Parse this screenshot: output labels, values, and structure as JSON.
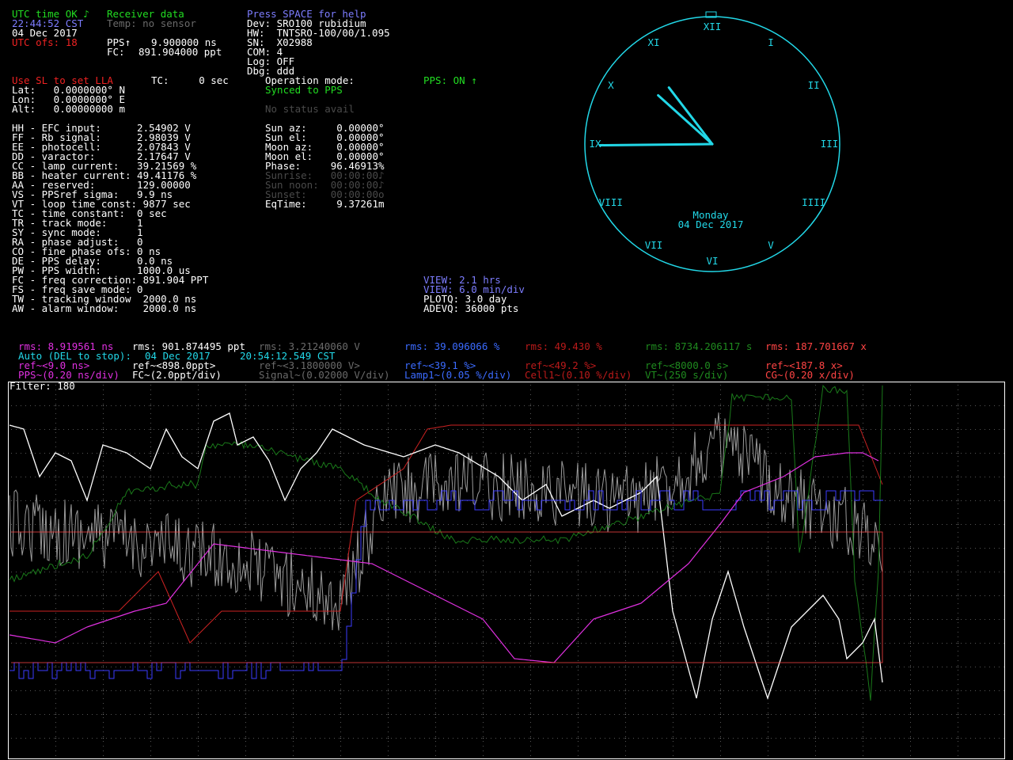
{
  "status": {
    "utc": "UTC time OK ♪",
    "time": "22:44:52 CST",
    "date": "04 Dec 2017",
    "utc_ofs": "UTC ofs: 18"
  },
  "receiver": {
    "title": "Receiver data",
    "temp": "Temp: no sensor",
    "pps_label": "PPS↑",
    "pps_value": "9.900000 ns",
    "fc_label": "FC:",
    "fc_value": "891.904000 ppt"
  },
  "device": {
    "help": "Press SPACE for help",
    "dev": "Dev: SRO100 rubidium",
    "hw": "HW:  TNTSRO-100/00/1.095",
    "sn": "SN:  X02988",
    "com": "COM: 4",
    "log": "Log: OFF",
    "dbg": "Dbg: ddd"
  },
  "location": {
    "hint": "Use SL to set LLA",
    "lat": "Lat:   0.0000000° N",
    "lon": "Lon:   0.0000000° E",
    "alt": "Alt:   0.00000000 m"
  },
  "tc_line": "TC:     0 sec",
  "operation": {
    "mode_label": "Operation mode:",
    "sync": "Synced to PPS",
    "no_status": "No status avail",
    "pps_on": "PPS: ON ↑"
  },
  "params": [
    "HH - EFC input:      2.54902 V",
    "FF - Rb signal:      2.98039 V",
    "EE - photocell:      2.07843 V",
    "DD - varactor:       2.17647 V",
    "CC - lamp current:   39.21569 %",
    "BB - heater current: 49.41176 %",
    "AA - reserved:       129.00000",
    "VS - PPSref sigma:   9.9 ns",
    "VT - loop time const: 9877 sec",
    "TC - time constant:  0 sec",
    "TR - track mode:     1",
    "SY - sync mode:      1",
    "RA - phase adjust:   0",
    "CO - fine phase ofs: 0 ns",
    "DE - PPS delay:      0.0 ns",
    "PW - PPS width:      1000.0 us",
    "FC - freq correction: 891.904 PPT",
    "FS - freq save mode: 0",
    "TW - tracking window  2000.0 ns",
    "AW - alarm window:    2000.0 ns"
  ],
  "astro": [
    {
      "text": "Sun az:     0.00000°",
      "dim": false
    },
    {
      "text": "Sun el:     0.00000°",
      "dim": false
    },
    {
      "text": "Moon az:    0.00000°",
      "dim": false
    },
    {
      "text": "Moon el:    0.00000°",
      "dim": false
    },
    {
      "text": "Phase:     96.46913%",
      "dim": false
    },
    {
      "text": "Sunrise:   00:00:00♪",
      "dim": true
    },
    {
      "text": "Sun noon:  00:00:00♪",
      "dim": true
    },
    {
      "text": "Sunset:    00:00:00o",
      "dim": true
    },
    {
      "text": "EqTime:     9.37261m",
      "dim": false
    }
  ],
  "view": {
    "span": "VIEW: 2.1 hrs",
    "div": "VIEW: 6.0 min/div",
    "plotq": "PLOTQ: 3.0 day",
    "adevq": "ADEVQ: 36000 pts"
  },
  "clock": {
    "day": "Monday",
    "date": "04 Dec 2017",
    "numerals": [
      "XII",
      "I",
      "II",
      "III",
      "IIII",
      "V",
      "VI",
      "VII",
      "VIII",
      "IX",
      "X",
      "XI"
    ],
    "hour": 10.75,
    "minute": 44.9,
    "second": 52,
    "color": "#22d8e8"
  },
  "rms_row": [
    {
      "text": "rms: 8.919561 ns",
      "cls": "mag"
    },
    {
      "text": "rms: 901.874495 ppt",
      "cls": "white"
    },
    {
      "text": "rms: 3.21240060 V",
      "cls": "gray"
    },
    {
      "text": "rms: 39.096066 %",
      "cls": "sblue"
    },
    {
      "text": "rms: 49.430 %",
      "cls": "dred"
    },
    {
      "text": "rms: 8734.206117 s",
      "cls": "dgreen"
    },
    {
      "text": "rms: 187.701667 x",
      "cls": "cg"
    }
  ],
  "auto_row": {
    "auto": "Auto (DEL to stop):",
    "date": "04 Dec 2017",
    "time": "20:54:12.549 CST"
  },
  "ref_row": [
    {
      "text": "ref~<9.0 ns>",
      "cls": "mag"
    },
    {
      "text": "ref~<898.0ppt>",
      "cls": "white"
    },
    {
      "text": "ref~<3.1800000 V>",
      "cls": "gray"
    },
    {
      "text": "ref~<39.1 %>",
      "cls": "sblue"
    },
    {
      "text": "ref~<49.2 %>",
      "cls": "dred"
    },
    {
      "text": "ref~<8000.0 s>",
      "cls": "dgreen"
    },
    {
      "text": "ref~<187.8 x>",
      "cls": "cg"
    }
  ],
  "scale_row": [
    {
      "text": "PPS~(0.20 ns/div)",
      "cls": "mag"
    },
    {
      "text": "FC~(2.0ppt/div)",
      "cls": "white"
    },
    {
      "text": "Signal~(0.02000 V/div)",
      "cls": "gray"
    },
    {
      "text": "Lamp1~(0.05 %/div)",
      "cls": "sblue"
    },
    {
      "text": "Cell1~(0.10 %/div)",
      "cls": "dred"
    },
    {
      "text": "VT~(250 s/div)",
      "cls": "dgreen"
    },
    {
      "text": "CG~(0.20 x/div)",
      "cls": "cg"
    }
  ],
  "filter": "Filter: 180",
  "plot_colors": {
    "pps": "#e030e0",
    "fc": "#ffffff",
    "signal": "#9a9a9a",
    "lamp": "#3b3bff",
    "cell": "#cc2222",
    "vt": "#1a7a1a",
    "cg": "#ff4444"
  }
}
